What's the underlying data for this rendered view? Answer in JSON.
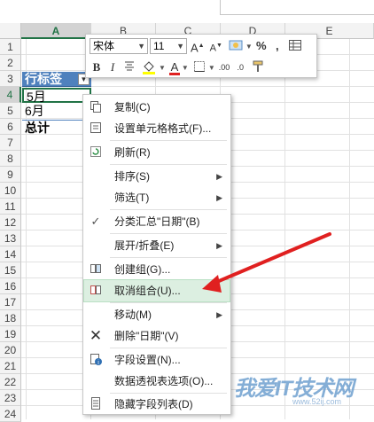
{
  "columns": [
    "A",
    "B",
    "C",
    "D",
    "E"
  ],
  "rows": [
    "1",
    "2",
    "3",
    "4",
    "5",
    "6",
    "7",
    "8",
    "9",
    "10",
    "11",
    "12",
    "13",
    "14",
    "15",
    "16",
    "17",
    "18",
    "19",
    "20",
    "21",
    "22",
    "23",
    "24"
  ],
  "cells": {
    "a3": "行标签",
    "a4": "5月",
    "a5": "6月",
    "a6": "总计"
  },
  "mini_toolbar": {
    "font_name": "宋体",
    "font_size": "11",
    "grow_font": "A",
    "shrink_font": "A",
    "percent": "%",
    "comma": ",",
    "bold": "B",
    "italic": "I",
    "font_color": "A",
    "inc_decimal": ".00",
    "dec_decimal": ".0"
  },
  "context_menu": {
    "items": [
      {
        "label": "复制(C)",
        "icon": "copy-icon"
      },
      {
        "label": "设置单元格格式(F)...",
        "icon": "format-cells-icon"
      },
      {
        "label": "刷新(R)",
        "icon": "refresh-icon"
      },
      {
        "label": "排序(S)",
        "icon": ""
      },
      {
        "label": "筛选(T)",
        "icon": ""
      },
      {
        "label": "分类汇总\"日期\"(B)",
        "icon": "checkmark-icon"
      },
      {
        "label": "展开/折叠(E)",
        "icon": ""
      },
      {
        "label": "创建组(G)...",
        "icon": "group-icon"
      },
      {
        "label": "取消组合(U)...",
        "icon": "ungroup-icon"
      },
      {
        "label": "移动(M)",
        "icon": ""
      },
      {
        "label": "删除\"日期\"(V)",
        "icon": "delete-x-icon"
      },
      {
        "label": "字段设置(N)...",
        "icon": "field-settings-icon"
      },
      {
        "label": "数据透视表选项(O)...",
        "icon": ""
      },
      {
        "label": "隐藏字段列表(D)",
        "icon": "field-list-icon"
      }
    ],
    "highlighted_item": "取消组合(U)..."
  },
  "colors": {
    "excel_green": "#217346",
    "pivot_header": "#4f81bd",
    "highlight": "#dcefe1",
    "annotation_arrow": "#e02020"
  },
  "watermark": {
    "text": "我爱IT技术网",
    "url": "www.52ij.com"
  }
}
